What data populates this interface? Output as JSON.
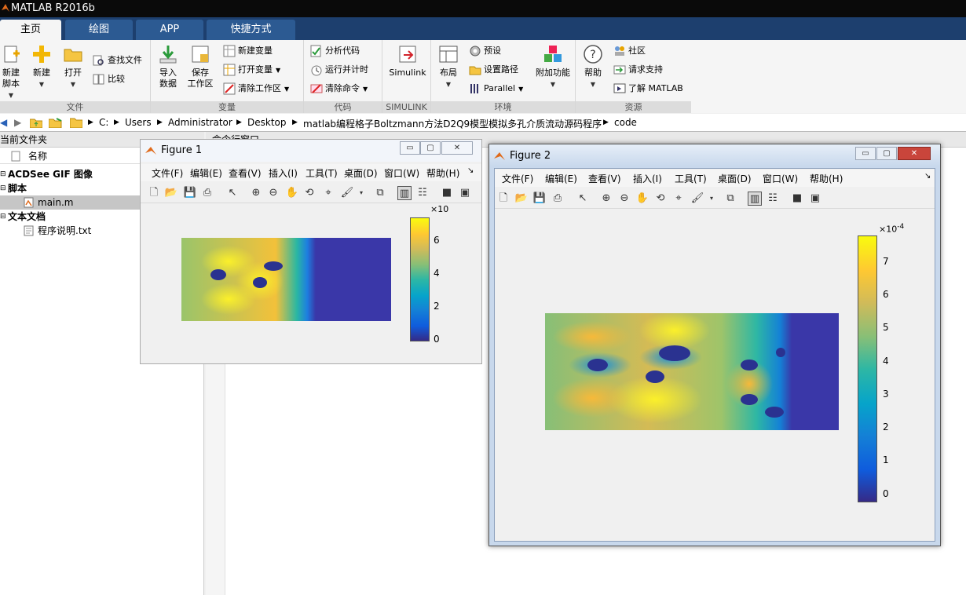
{
  "app": {
    "title": "MATLAB R2016b"
  },
  "tabs": [
    "主页",
    "绘图",
    "APP",
    "快捷方式"
  ],
  "ribbon": {
    "groups": {
      "file": "文件",
      "variable": "变量",
      "code": "代码",
      "simulink": "SIMULINK",
      "environment": "环境",
      "resources": "资源"
    },
    "new_script": [
      "新建",
      "脚本"
    ],
    "new": "新建",
    "open": "打开",
    "find_files": "查找文件",
    "compare": "比较",
    "import": [
      "导入",
      "数据"
    ],
    "save_ws": [
      "保存",
      "工作区"
    ],
    "new_var": "新建变量",
    "open_var": "打开变量",
    "clear_ws": "清除工作区",
    "analyze": "分析代码",
    "run_time": "运行并计时",
    "clear_cmd": "清除命令",
    "simulink": "Simulink",
    "layout": "布局",
    "prefs": "预设",
    "set_path": "设置路径",
    "parallel": "Parallel",
    "addons": "附加功能",
    "help": "帮助",
    "community": "社区",
    "support": "请求支持",
    "learn": "了解 MATLAB"
  },
  "address": {
    "parts": [
      "C:",
      "Users",
      "Administrator",
      "Desktop",
      "matlab编程格子Boltzmann方法D2Q9模型模拟多孔介质流动源码程序",
      "code"
    ]
  },
  "current_folder": {
    "title": "当前文件夹",
    "col_name": "名称",
    "items": [
      {
        "label": "ACDSee GIF 图像",
        "type": "group"
      },
      {
        "label": "脚本",
        "type": "group"
      },
      {
        "label": "main.m",
        "type": "file"
      },
      {
        "label": "文本文档",
        "type": "group"
      },
      {
        "label": "程序说明.txt",
        "type": "file"
      }
    ]
  },
  "command_window": {
    "title": "命令行窗口"
  },
  "figure1": {
    "title": "Figure 1",
    "menu": [
      "文件(F)",
      "编辑(E)",
      "查看(V)",
      "插入(I)",
      "工具(T)",
      "桌面(D)",
      "窗口(W)",
      "帮助(H)"
    ],
    "colorbar": {
      "exponent": "×10",
      "ticks": [
        "6",
        "4",
        "2",
        "0"
      ],
      "range": [
        0,
        7.4
      ]
    }
  },
  "figure2": {
    "title": "Figure 2",
    "menu": [
      "文件(F)",
      "编辑(E)",
      "查看(V)",
      "插入(I)",
      "工具(T)",
      "桌面(D)",
      "窗口(W)",
      "帮助(H)"
    ],
    "colorbar": {
      "exponent": "×10",
      "exponent_power": "-4",
      "ticks": [
        "7",
        "6",
        "5",
        "4",
        "3",
        "2",
        "1",
        "0"
      ],
      "range": [
        0,
        7.8
      ]
    }
  },
  "colors": {
    "ribbon_dark": "#1d3f6e",
    "tab": "#2c5a92",
    "parula_low": "#352a87",
    "parula_high": "#f9fb0e"
  }
}
